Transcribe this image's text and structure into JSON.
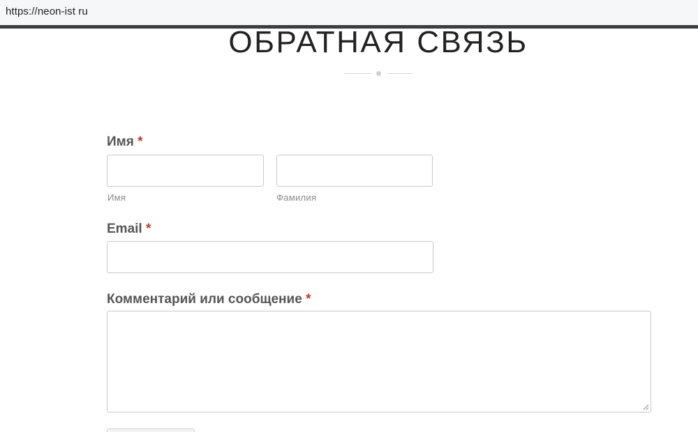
{
  "browser": {
    "url": "https://neon-ist ru"
  },
  "page": {
    "title": "ОБРАТНАЯ СВЯЗЬ"
  },
  "form": {
    "name_field": {
      "label": "Имя",
      "required_mark": "*",
      "first_value": "",
      "first_sublabel": "Имя",
      "last_value": "",
      "last_sublabel": "Фамилия"
    },
    "email_field": {
      "label": "Email",
      "required_mark": "*",
      "value": ""
    },
    "comment_field": {
      "label": "Комментарий или сообщение",
      "required_mark": "*",
      "value": ""
    }
  },
  "colors": {
    "required_mark": "#c0392b",
    "label_text": "#555555",
    "input_border": "#c8c8c8"
  }
}
